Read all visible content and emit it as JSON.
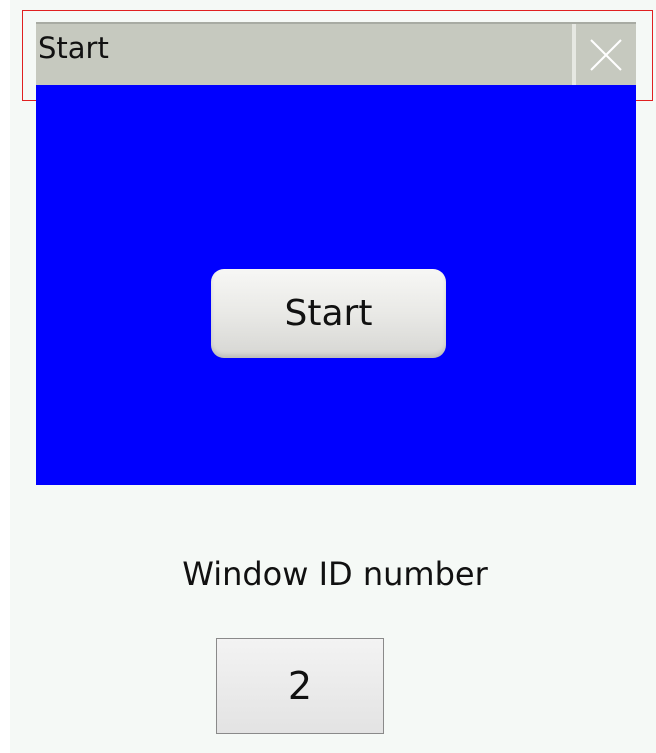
{
  "window": {
    "title": "Start",
    "close_icon": "close-icon"
  },
  "panel": {
    "background_color": "#0000ff",
    "start_button_label": "Start"
  },
  "window_id": {
    "label": "Window ID number",
    "value": "2"
  },
  "colors": {
    "titlebar": "#c6c9bf",
    "page_background": "#f5f9f6",
    "highlight": "#e02020"
  }
}
